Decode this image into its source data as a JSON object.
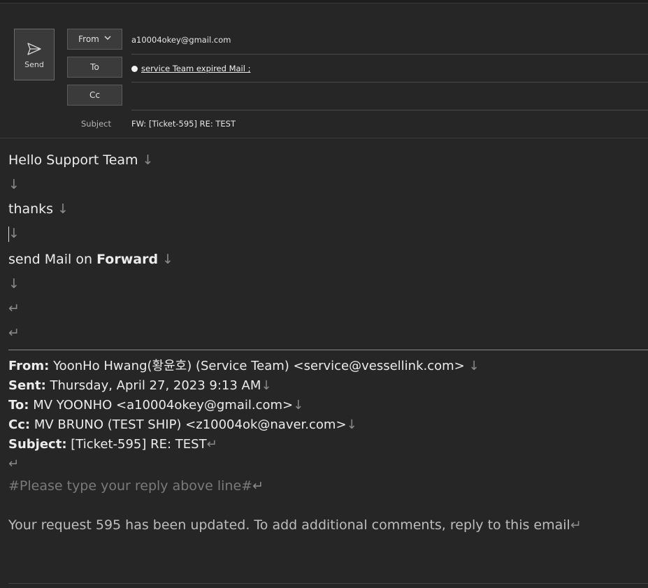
{
  "compose": {
    "send_label": "Send",
    "from_label": "From",
    "to_label": "To",
    "cc_label": "Cc",
    "subject_label": "Subject",
    "from_value": "a10004okey@gmail.com",
    "to_recipient": "service Team expired Mail ;",
    "cc_value": "",
    "subject_value": "FW: [Ticket-595] RE: TEST"
  },
  "body": {
    "greeting": "Hello Support Team",
    "thanks": "thanks",
    "forward_prefix": "send Mail on ",
    "forward_bold": "Forward",
    "line_break_mark": "↓",
    "paragraph_mark": "↵"
  },
  "quoted": {
    "from_label": "From:",
    "from_value": "YoonHo Hwang(황윤호) (Service Team) <service@vessellink.com>",
    "sent_label": "Sent:",
    "sent_value": "Thursday, April 27, 2023 9:13 AM",
    "to_label": "To:",
    "to_value": "MV YOONHO <a10004okey@gmail.com>",
    "cc_label": "Cc:",
    "cc_value": "MV BRUNO (TEST SHIP) <z10004ok@naver.com>",
    "subject_label": "Subject:",
    "subject_value": "[Ticket-595] RE: TEST",
    "reply_hint": "#Please type your reply above line#",
    "update_text": "Your request 595 has been updated. To add additional comments, reply to this email"
  },
  "colors": {
    "background": "#262626",
    "text": "#e8e8e8",
    "mark": "#8a8a8a",
    "button": "#3b3b3b"
  }
}
